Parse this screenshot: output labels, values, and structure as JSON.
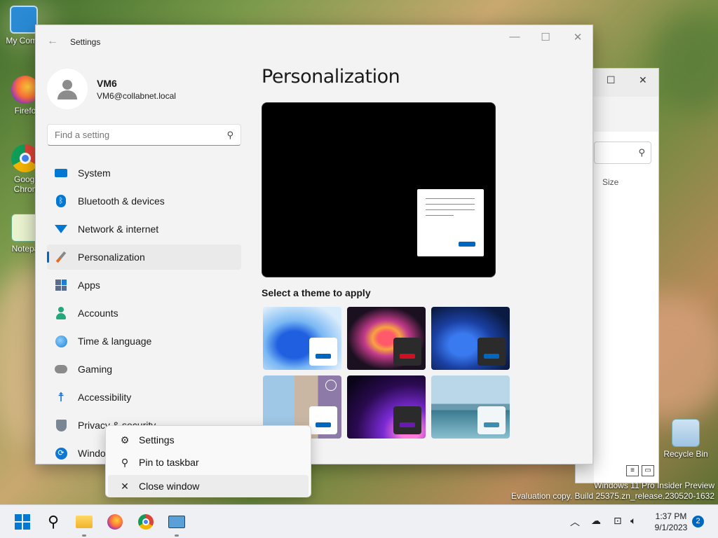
{
  "desktop": {
    "icons": [
      {
        "label": "My Comp",
        "icon": "computer-icon"
      },
      {
        "label": "Firefo",
        "icon": "firefox-icon"
      },
      {
        "label": "Googl",
        "label2": "Chron",
        "icon": "chrome-icon"
      },
      {
        "label": "Notepa",
        "icon": "notepad-icon"
      },
      {
        "label": "Recycle Bin",
        "icon": "recycle-bin-icon"
      }
    ],
    "watermark_line1": "Windows 11 Pro Insider Preview",
    "watermark_line2": "Evaluation copy. Build 25375.zn_release.230520-1632"
  },
  "explorer": {
    "column_size": "Size"
  },
  "settings": {
    "title": "Settings",
    "user": {
      "name": "VM6",
      "email": "VM6@collabnet.local"
    },
    "search_placeholder": "Find a setting",
    "nav": [
      {
        "label": "System",
        "icon": "system-icon",
        "color": "#0078d4"
      },
      {
        "label": "Bluetooth & devices",
        "icon": "bluetooth-icon",
        "color": "#0078d4"
      },
      {
        "label": "Network & internet",
        "icon": "wifi-icon",
        "color": "#0078d4"
      },
      {
        "label": "Personalization",
        "icon": "brush-icon",
        "color": "#e06c2a",
        "active": true
      },
      {
        "label": "Apps",
        "icon": "apps-icon",
        "color": "#5b6d8a"
      },
      {
        "label": "Accounts",
        "icon": "accounts-icon",
        "color": "#22a87a"
      },
      {
        "label": "Time & language",
        "icon": "globe-icon",
        "color": "#1a7fd4"
      },
      {
        "label": "Gaming",
        "icon": "gamepad-icon",
        "color": "#8a8a8a"
      },
      {
        "label": "Accessibility",
        "icon": "accessibility-icon",
        "color": "#1a6fd4"
      },
      {
        "label": "Privacy & security",
        "icon": "shield-icon",
        "color": "#7a8694"
      },
      {
        "label": "Windo",
        "icon": "update-icon",
        "color": "#0a78d4"
      }
    ],
    "page_title": "Personalization",
    "theme_caption": "Select a theme to apply"
  },
  "context_menu": {
    "items": [
      {
        "label": "Settings",
        "icon": "gear-icon"
      },
      {
        "label": "Pin to taskbar",
        "icon": "pin-icon"
      },
      {
        "label": "Close window",
        "icon": "close-icon"
      }
    ]
  },
  "taskbar": {
    "time": "1:37 PM",
    "date": "9/1/2023",
    "notification_count": "2"
  }
}
